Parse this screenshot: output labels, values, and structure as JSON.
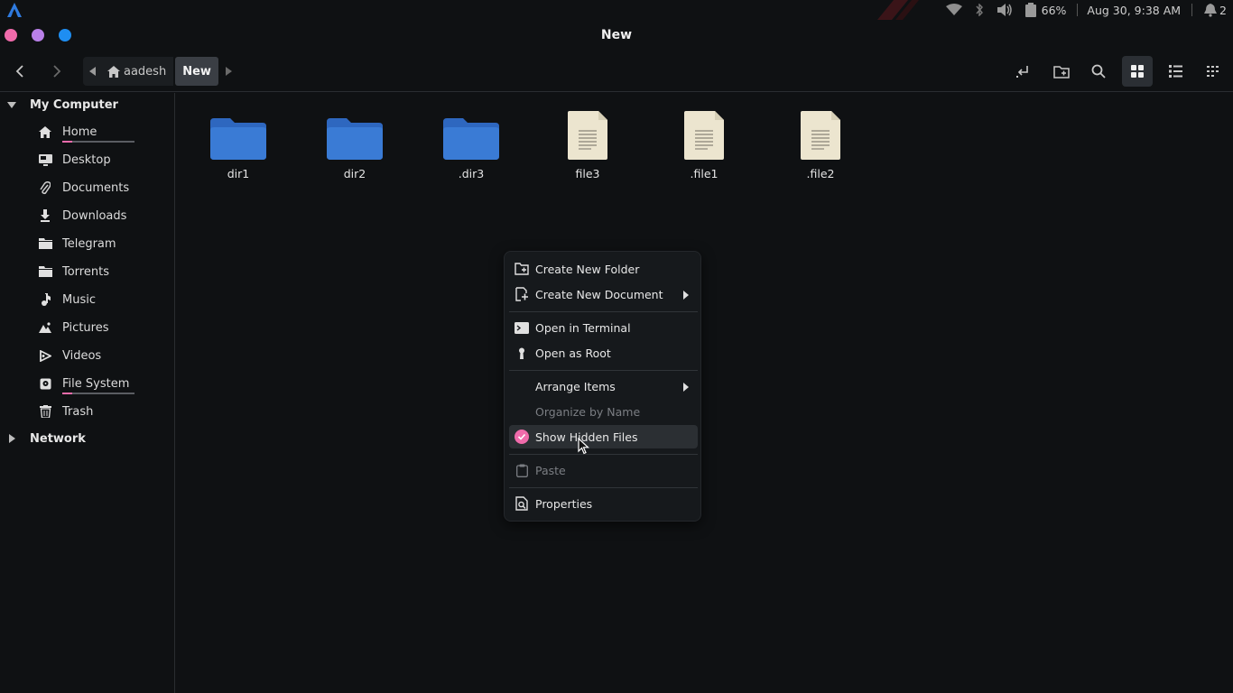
{
  "window": {
    "title": "New"
  },
  "panel": {
    "battery": "66%",
    "clock": "Aug 30,  9:38 AM",
    "notifications": "2"
  },
  "breadcrumb": {
    "home_label": "aadesh",
    "current_label": "New"
  },
  "sidebar": {
    "sections": {
      "my_computer": "My Computer",
      "network": "Network"
    },
    "items": [
      {
        "label": "Home",
        "icon": "home-icon",
        "usage": 0.14
      },
      {
        "label": "Desktop",
        "icon": "desktop-icon"
      },
      {
        "label": "Documents",
        "icon": "paperclip-icon"
      },
      {
        "label": "Downloads",
        "icon": "download-icon"
      },
      {
        "label": "Telegram",
        "icon": "folder-icon"
      },
      {
        "label": "Torrents",
        "icon": "folder-icon"
      },
      {
        "label": "Music",
        "icon": "music-icon"
      },
      {
        "label": "Pictures",
        "icon": "pictures-icon"
      },
      {
        "label": "Videos",
        "icon": "video-icon"
      },
      {
        "label": "File System",
        "icon": "drive-icon",
        "usage": 0.14
      },
      {
        "label": "Trash",
        "icon": "trash-icon"
      }
    ]
  },
  "files": [
    {
      "name": "dir1",
      "type": "folder"
    },
    {
      "name": "dir2",
      "type": "folder"
    },
    {
      "name": ".dir3",
      "type": "folder"
    },
    {
      "name": "file3",
      "type": "file"
    },
    {
      "name": ".file1",
      "type": "file"
    },
    {
      "name": ".file2",
      "type": "file"
    }
  ],
  "context_menu": {
    "create_folder": "Create New Folder",
    "create_document": "Create New Document",
    "open_terminal": "Open in Terminal",
    "open_root": "Open as Root",
    "arrange_items": "Arrange Items",
    "organize_by_name": "Organize by Name",
    "show_hidden": "Show Hidden Files",
    "paste": "Paste",
    "properties": "Properties"
  },
  "colors": {
    "accent": "#f06bab",
    "folder": "#3a7bd5",
    "file": "#ece5cf",
    "close": "#f06bab",
    "minimize": "#b980e8",
    "maximize": "#1e8ef2"
  }
}
